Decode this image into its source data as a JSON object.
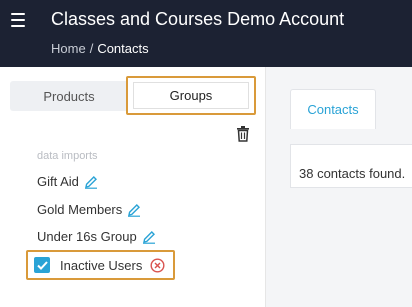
{
  "header": {
    "title": "Classes and Courses Demo Account",
    "breadcrumb": {
      "home": "Home",
      "separator": "/",
      "current": "Contacts"
    }
  },
  "left_panel": {
    "tabs": [
      {
        "label": "Products",
        "selected": false
      },
      {
        "label": "Groups",
        "selected": true
      }
    ],
    "section_label": "data imports",
    "groups": [
      {
        "label": "Gift Aid",
        "editable": true
      },
      {
        "label": "Gold Members",
        "editable": true
      },
      {
        "label": "Under 16s Group",
        "editable": true
      }
    ],
    "selected_group": {
      "label": "Inactive Users",
      "checked": true
    }
  },
  "right_panel": {
    "tab_label": "Contacts",
    "count_text": "38 contacts found."
  },
  "colors": {
    "header_bg": "#1c2233",
    "accent": "#2aa3d6",
    "highlight": "#d99a3a"
  }
}
